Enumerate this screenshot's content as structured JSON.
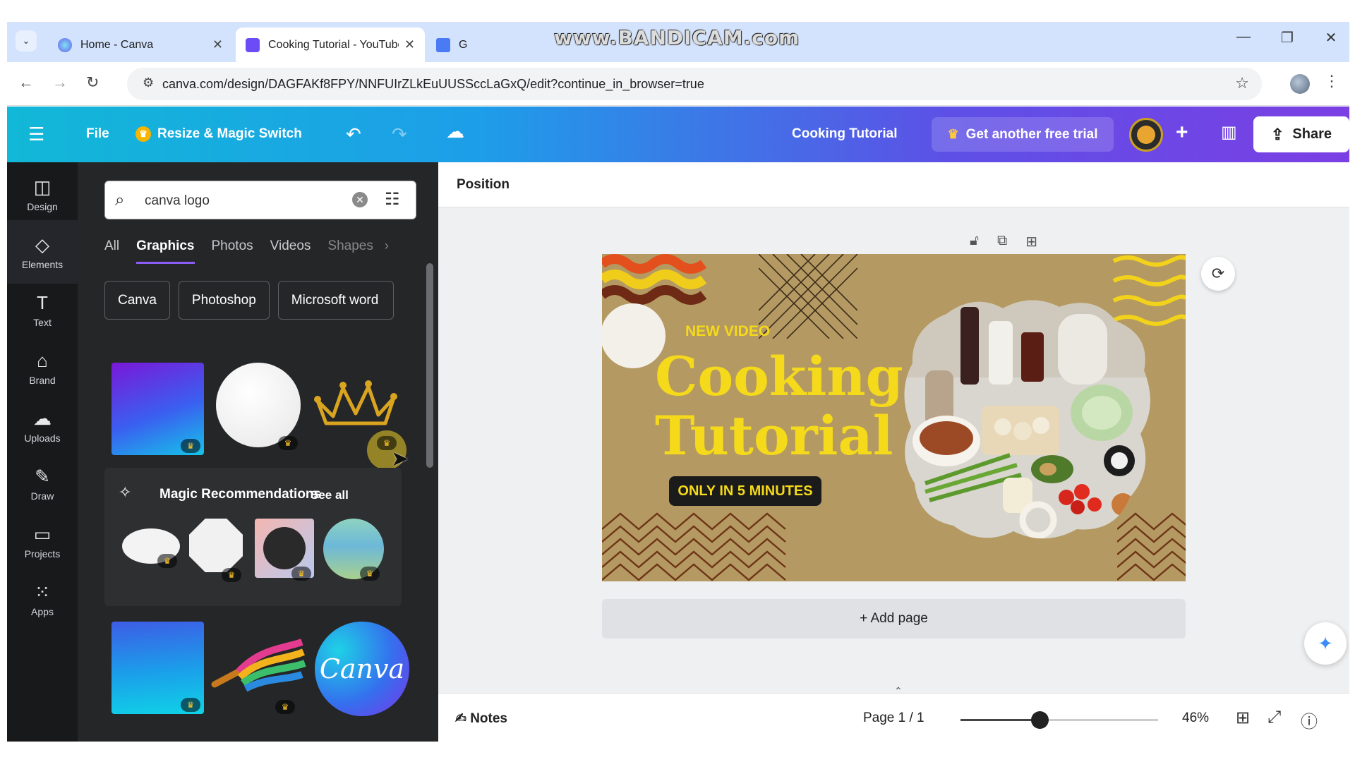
{
  "watermark": "www.BANDICAM.com",
  "browser": {
    "tabs": [
      {
        "title": "Home - Canva",
        "active": false
      },
      {
        "title": "Cooking Tutorial - YouTube Th",
        "active": true
      },
      {
        "title": "G",
        "active": false
      }
    ],
    "url": "canva.com/design/DAGFAKf8FPY/NNFUIrZLkEuUUSSccLaGxQ/edit?continue_in_browser=true"
  },
  "header": {
    "file_label": "File",
    "resize_label": "Resize & Magic Switch",
    "design_title": "Cooking Tutorial",
    "trial_label": "Get another free trial",
    "share_label": "Share",
    "accent_colors": [
      "#12b8d7",
      "#5d50e6",
      "#7b3fe4"
    ]
  },
  "rail": {
    "items": [
      {
        "label": "Design",
        "icon": "layout-icon"
      },
      {
        "label": "Elements",
        "icon": "shapes-icon",
        "selected": true
      },
      {
        "label": "Text",
        "icon": "text-icon"
      },
      {
        "label": "Brand",
        "icon": "briefcase-icon"
      },
      {
        "label": "Uploads",
        "icon": "upload-icon"
      },
      {
        "label": "Draw",
        "icon": "pen-icon"
      },
      {
        "label": "Projects",
        "icon": "folder-icon"
      },
      {
        "label": "Apps",
        "icon": "grid-icon"
      }
    ]
  },
  "panel": {
    "search_value": "canva logo",
    "tabs": [
      "All",
      "Graphics",
      "Photos",
      "Videos",
      "Shapes"
    ],
    "active_tab": "Graphics",
    "chips": [
      "Canva",
      "Photoshop",
      "Microsoft word"
    ],
    "magic_title": "Magic Recommendations",
    "see_all": "See all",
    "canva_logo_text": "Canva"
  },
  "editor": {
    "toolbar_title": "Position",
    "canvas": {
      "kicker": "NEW VIDEO",
      "title_line1": "Cooking",
      "title_line2": "Tutorial",
      "pill": "ONLY IN 5 MINUTES"
    },
    "add_page": "+ Add page",
    "notes": "Notes",
    "page_indicator": "Page 1 / 1",
    "zoom_percent": "46%",
    "zoom_fraction": 0.4
  }
}
